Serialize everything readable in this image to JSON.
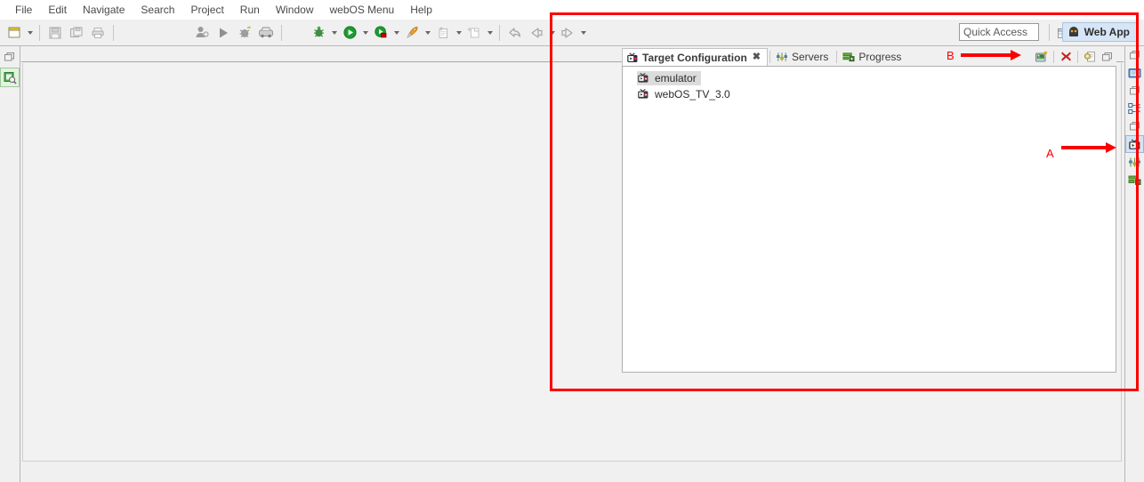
{
  "menubar": {
    "items": [
      {
        "label": "File"
      },
      {
        "label": "Edit"
      },
      {
        "label": "Navigate"
      },
      {
        "label": "Search"
      },
      {
        "label": "Project"
      },
      {
        "label": "Run"
      },
      {
        "label": "Window"
      },
      {
        "label": "webOS Menu"
      },
      {
        "label": "Help"
      }
    ]
  },
  "toolbar": {
    "buttons": [
      {
        "name": "new-wizard-icon",
        "has_dropdown": true
      },
      {
        "name": "save-icon",
        "has_dropdown": false
      },
      {
        "name": "save-all-icon",
        "has_dropdown": false
      },
      {
        "name": "print-icon",
        "has_dropdown": false
      },
      {
        "name": "open-type-icon",
        "has_dropdown": false
      },
      {
        "name": "run-play-icon",
        "has_dropdown": false
      },
      {
        "name": "debug-bug-icon",
        "has_dropdown": false
      },
      {
        "name": "inspect-icon",
        "has_dropdown": false
      },
      {
        "name": "debug-green-bug-icon",
        "has_dropdown": true
      },
      {
        "name": "run-green-icon",
        "has_dropdown": true
      },
      {
        "name": "run-package-icon",
        "has_dropdown": true
      },
      {
        "name": "external-tools-icon",
        "has_dropdown": true
      },
      {
        "name": "new-file-icon",
        "has_dropdown": true
      },
      {
        "name": "new-folder-icon",
        "has_dropdown": true
      },
      {
        "name": "back-arrow-icon",
        "has_dropdown": false
      },
      {
        "name": "previous-edit-icon",
        "has_dropdown": true
      },
      {
        "name": "forward-arrow-icon",
        "has_dropdown": true
      }
    ],
    "quick_access_placeholder": "Quick Access",
    "open-perspective-icon": "open-perspective-icon",
    "perspective": {
      "label": "Web App",
      "icon": "web-app-icon",
      "active": true
    }
  },
  "left_fastview": {
    "items": [
      {
        "name": "restore-icon",
        "selected": false
      },
      {
        "name": "project-explorer-icon",
        "selected": true
      }
    ]
  },
  "right_fastview": {
    "items": [
      {
        "name": "restore-icon",
        "selected": false
      },
      {
        "name": "console-monitor-icon",
        "selected": false
      },
      {
        "name": "restore-icon",
        "selected": false
      },
      {
        "name": "outline-icon",
        "selected": false
      },
      {
        "name": "restore-icon",
        "selected": false
      },
      {
        "name": "target-configuration-icon",
        "selected": true
      },
      {
        "name": "servers-icon",
        "selected": false
      },
      {
        "name": "progress-icon",
        "selected": false
      }
    ]
  },
  "target_configuration_view": {
    "tabs": [
      {
        "label": "Target Configuration",
        "icon": "target-configuration-icon",
        "active": true,
        "closeable": true
      },
      {
        "label": "Servers",
        "icon": "servers-icon",
        "active": false,
        "closeable": false
      },
      {
        "label": "Progress",
        "icon": "progress-icon",
        "active": false,
        "closeable": false
      }
    ],
    "toolbar": [
      {
        "name": "new-target-icon"
      },
      {
        "name": "delete-target-icon"
      },
      {
        "name": "target-properties-icon"
      },
      {
        "name": "view-menu-minimize-icon"
      }
    ],
    "tree": [
      {
        "label": "emulator",
        "icon": "device-tv-icon",
        "selected": true
      },
      {
        "label": "webOS_TV_3.0",
        "icon": "device-tv-icon",
        "selected": false
      }
    ]
  },
  "annotations": {
    "callout_a": "A",
    "callout_b": "B",
    "highlight_color": "#fb0000"
  }
}
